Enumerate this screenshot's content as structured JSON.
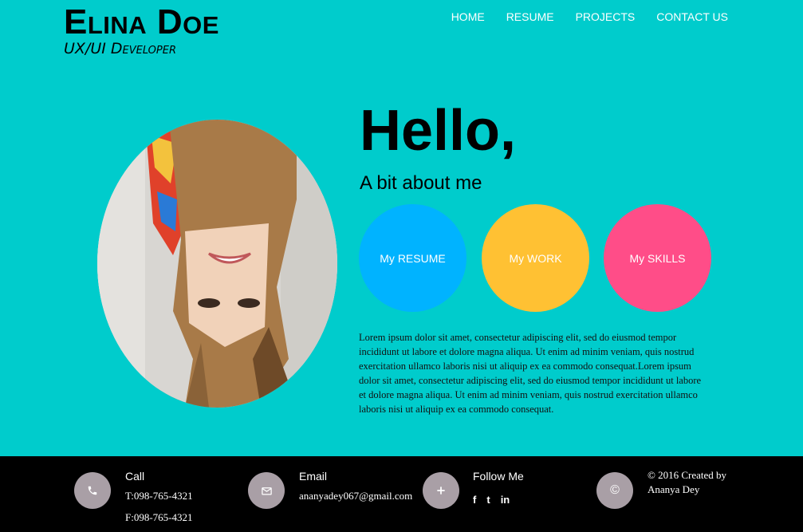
{
  "brand": {
    "name": "Elina Doe",
    "role": "UX/UI Developer"
  },
  "nav": {
    "home": "HOME",
    "resume": "RESUME",
    "projects": "PROJECTS",
    "contact": "CONTACT US"
  },
  "hero": {
    "greeting": "Hello,",
    "subtitle": "A bit about me",
    "buttons": [
      {
        "label": "My RESUME",
        "color": "#00b3ff"
      },
      {
        "label": "My WORK",
        "color": "#ffc133"
      },
      {
        "label": "My SKILLS",
        "color": "#ff4d88"
      }
    ],
    "bio": "Lorem ipsum dolor sit amet, consectetur adipiscing elit, sed do eiusmod tempor incididunt ut labore et dolore magna aliqua. Ut enim ad minim veniam, quis nostrud exercitation ullamco laboris nisi ut aliquip ex ea commodo consequat.Lorem ipsum dolor sit amet, consectetur adipiscing elit, sed do eiusmod tempor incididunt ut labore et dolore magna aliqua. Ut enim ad minim veniam, quis nostrud exercitation ullamco laboris nisi ut aliquip ex ea commodo consequat."
  },
  "footer": {
    "call": {
      "title": "Call",
      "tel": "T:098-765-4321",
      "fax": "F:098-765-4321",
      "icon": "phone-icon"
    },
    "email": {
      "title": "Email",
      "address": "ananyadey067@gmail.com",
      "icon": "envelope-icon"
    },
    "follow": {
      "title": "Follow Me",
      "icon": "plus-icon",
      "facebook": "f",
      "twitter": "t",
      "linkedin": "in"
    },
    "copyright": {
      "line1": "© 2016 Created by",
      "line2": "Ananya Dey",
      "icon": "copyright-icon"
    }
  },
  "colors": {
    "background": "#00cccc",
    "footer": "#000000",
    "footer_icon": "#a99fa6"
  }
}
